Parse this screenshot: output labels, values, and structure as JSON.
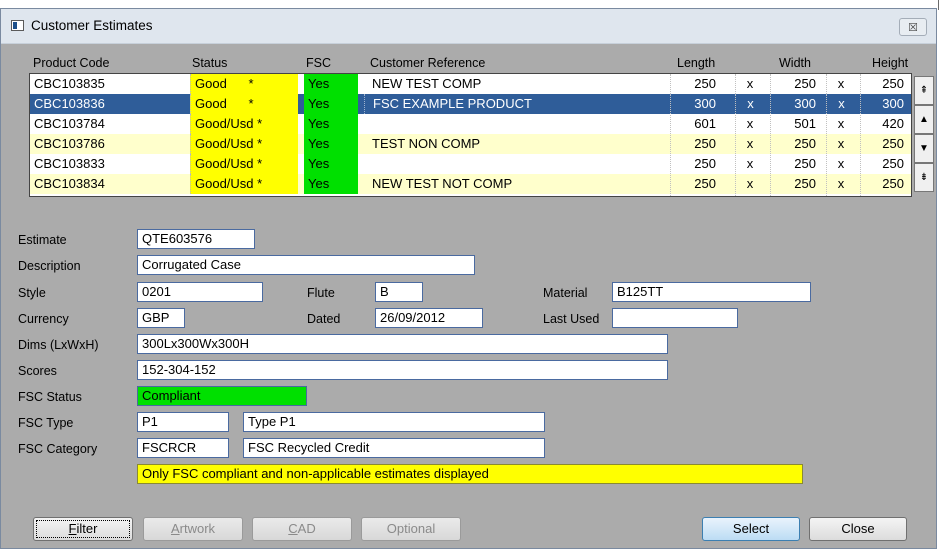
{
  "window": {
    "title": "Customer Estimates",
    "close_glyph": "☒"
  },
  "grid": {
    "columns": {
      "code": "Product Code",
      "status": "Status",
      "fsc": "FSC",
      "ref": "Customer Reference",
      "length": "Length",
      "width": "Width",
      "height": "Height"
    },
    "rows": [
      {
        "code": "CBC103835",
        "status": "Good      *",
        "fsc": "Yes",
        "ref": "NEW TEST COMP",
        "length": "250",
        "x1": "x",
        "width": "250",
        "x2": "x",
        "height": "250"
      },
      {
        "code": "CBC103836",
        "status": "Good      *",
        "fsc": "Yes",
        "ref": "FSC EXAMPLE PRODUCT",
        "length": "300",
        "x1": "x",
        "width": "300",
        "x2": "x",
        "height": "300"
      },
      {
        "code": "CBC103784",
        "status": "Good/Usd *",
        "fsc": "Yes",
        "ref": "",
        "length": "601",
        "x1": "x",
        "width": "501",
        "x2": "x",
        "height": "420"
      },
      {
        "code": "CBC103786",
        "status": "Good/Usd *",
        "fsc": "Yes",
        "ref": "TEST NON COMP",
        "length": "250",
        "x1": "x",
        "width": "250",
        "x2": "x",
        "height": "250"
      },
      {
        "code": "CBC103833",
        "status": "Good/Usd *",
        "fsc": "Yes",
        "ref": "",
        "length": "250",
        "x1": "x",
        "width": "250",
        "x2": "x",
        "height": "250"
      },
      {
        "code": "CBC103834",
        "status": "Good/Usd *",
        "fsc": "Yes",
        "ref": "NEW TEST NOT COMP",
        "length": "250",
        "x1": "x",
        "width": "250",
        "x2": "x",
        "height": "250"
      }
    ],
    "selected_row": "CBC103836",
    "scroll_glyphs": {
      "top": "⇞",
      "up": "▲",
      "down": "▼",
      "bottom": "⇟"
    }
  },
  "form": {
    "estimate": {
      "label": "Estimate",
      "value": "QTE603576"
    },
    "description": {
      "label": "Description",
      "value": "Corrugated Case"
    },
    "style": {
      "label": "Style",
      "value": "0201"
    },
    "flute": {
      "label": "Flute",
      "value": "B"
    },
    "material": {
      "label": "Material",
      "value": "B125TT"
    },
    "currency": {
      "label": "Currency",
      "value": "GBP"
    },
    "dated": {
      "label": "Dated",
      "value": "26/09/2012"
    },
    "last_used": {
      "label": "Last Used",
      "value": ""
    },
    "dims": {
      "label": "Dims (LxWxH)",
      "value": "300Lx300Wx300H"
    },
    "scores": {
      "label": "Scores",
      "value": "152-304-152"
    },
    "fsc_status": {
      "label": "FSC Status",
      "value": "Compliant"
    },
    "fsc_type": {
      "label": "FSC Type",
      "code": "P1",
      "desc": "Type P1"
    },
    "fsc_category": {
      "label": "FSC Category",
      "code": "FSCRCR",
      "desc": "FSC Recycled Credit"
    },
    "notice": "Only FSC compliant and non-applicable estimates displayed"
  },
  "buttons": {
    "filter": {
      "first": "F",
      "rest": "ilter"
    },
    "artwork": {
      "first": "A",
      "rest": "rtwork"
    },
    "cad": {
      "first": "C",
      "rest": "AD"
    },
    "optional": "Optional",
    "select": "Select",
    "close": "Close"
  },
  "colors": {
    "selected_row": "#2f5d99",
    "status_cell": "#ffff00",
    "fsc_cell": "#00e000",
    "alt_row": "#ffffcc",
    "window_bg": "#ababab"
  }
}
